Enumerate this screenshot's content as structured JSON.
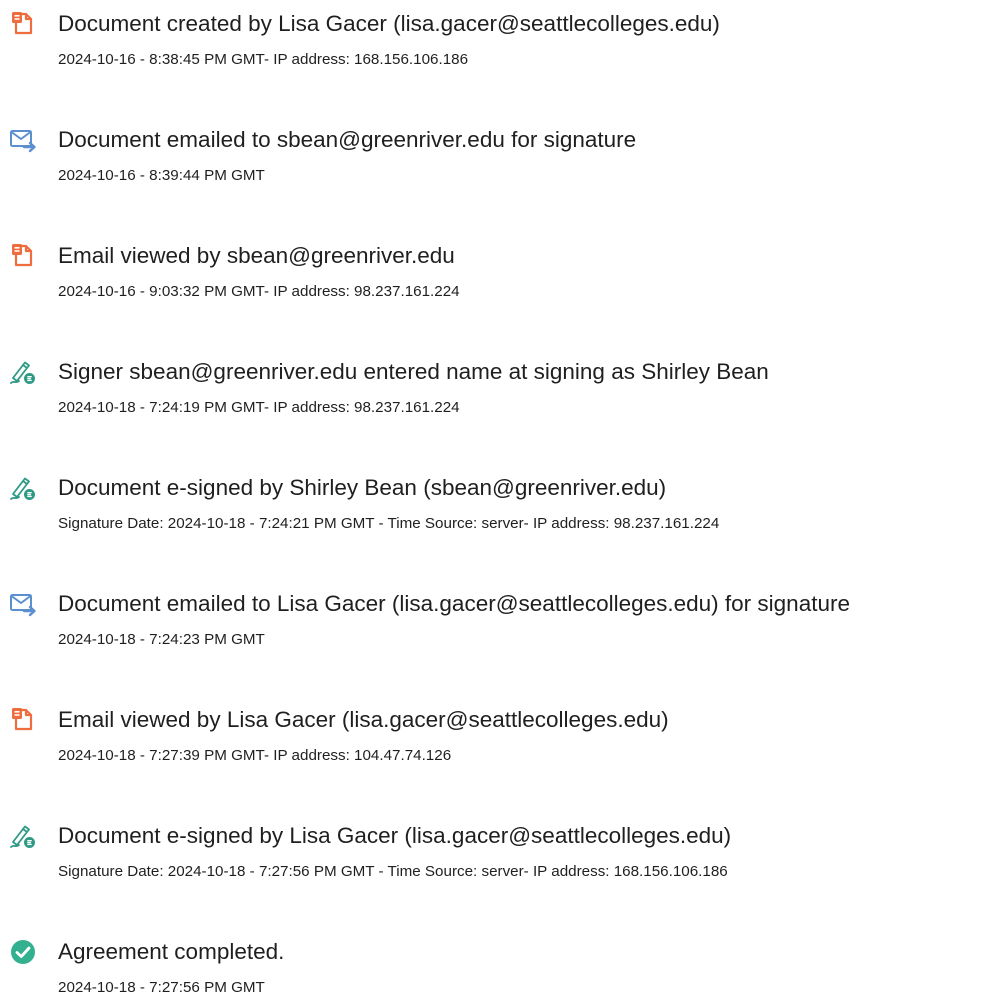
{
  "colors": {
    "doc_icon": "#ef6c3e",
    "email_icon": "#5a8fd1",
    "sign_icon": "#2e9a86",
    "complete_icon": "#33b08f"
  },
  "events": [
    {
      "icon": "document-icon",
      "title": "Document created by Lisa Gacer (lisa.gacer@seattlecolleges.edu)",
      "meta": "2024-10-16 - 8:38:45 PM GMT- IP address: 168.156.106.186"
    },
    {
      "icon": "email-sent-icon",
      "title": "Document emailed to sbean@greenriver.edu for signature",
      "meta": "2024-10-16 - 8:39:44 PM GMT"
    },
    {
      "icon": "document-icon",
      "title": "Email viewed by sbean@greenriver.edu",
      "meta": "2024-10-16 - 9:03:32 PM GMT- IP address: 98.237.161.224"
    },
    {
      "icon": "pen-signature-icon",
      "title": "Signer sbean@greenriver.edu entered name at signing as Shirley Bean",
      "meta": "2024-10-18 - 7:24:19 PM GMT- IP address: 98.237.161.224"
    },
    {
      "icon": "pen-signature-icon",
      "title": "Document e-signed by Shirley Bean (sbean@greenriver.edu)",
      "meta": "Signature Date: 2024-10-18 - 7:24:21 PM GMT - Time Source: server- IP address: 98.237.161.224"
    },
    {
      "icon": "email-sent-icon",
      "title": "Document emailed to Lisa Gacer (lisa.gacer@seattlecolleges.edu) for signature",
      "meta": "2024-10-18 - 7:24:23 PM GMT"
    },
    {
      "icon": "document-icon",
      "title": "Email viewed by Lisa Gacer (lisa.gacer@seattlecolleges.edu)",
      "meta": "2024-10-18 - 7:27:39 PM GMT- IP address: 104.47.74.126"
    },
    {
      "icon": "pen-signature-icon",
      "title": "Document e-signed by Lisa Gacer (lisa.gacer@seattlecolleges.edu)",
      "meta": "Signature Date: 2024-10-18 - 7:27:56 PM GMT - Time Source: server- IP address: 168.156.106.186"
    },
    {
      "icon": "check-circle-icon",
      "title": "Agreement completed.",
      "meta": "2024-10-18 - 7:27:56 PM GMT"
    }
  ]
}
